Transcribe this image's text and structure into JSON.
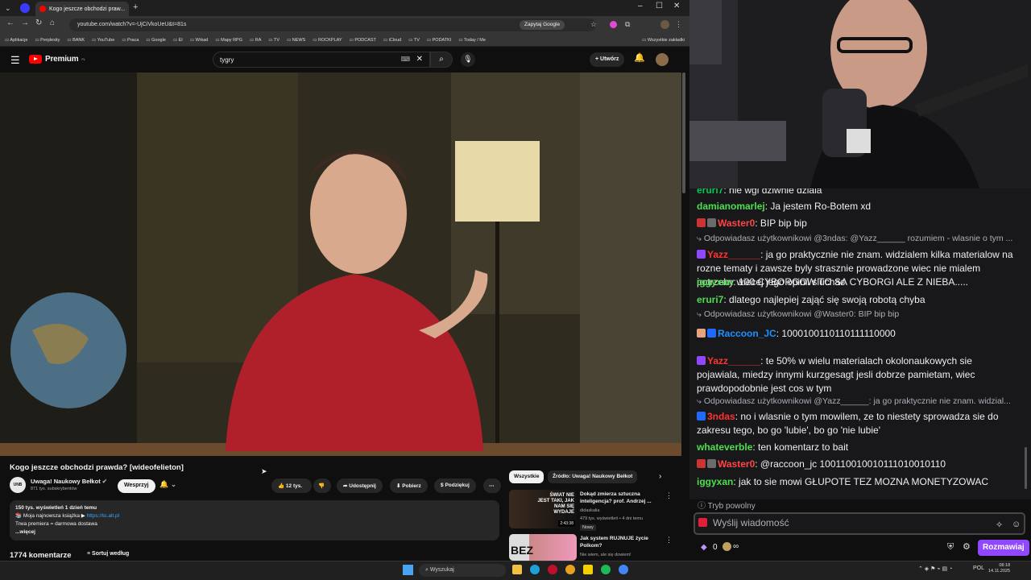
{
  "browser": {
    "tab_title": "Kogo jeszcze obchodzi praw...",
    "url": "youtube.com/watch?v=-UjCiVkoUeU&t=81s",
    "ask_google": "Zapytaj Google",
    "bookmarks": [
      "Aplikacje",
      "Perplexity",
      "BANK",
      "YouTube",
      "Praca",
      "Google",
      "EI",
      "Wrkad",
      "Mapy RPG",
      "RA",
      "TV",
      "NEWS",
      "ROCKPLAY",
      "PODCAST",
      "iCloud",
      "TV",
      "PODATKI",
      "Today / Me"
    ],
    "all_bookmarks": "Wszystkie zakładki"
  },
  "youtube": {
    "logo": "Premium",
    "logo_region": "PL",
    "search_value": "tygry",
    "create_label": "Utwórz",
    "video_title": "Kogo jeszcze obchodzi prawda? [wideofelieton]",
    "channel_avatar_text": "UNB",
    "channel_name": "Uwaga! Naukowy Bełkot",
    "subscribers": "871 tys. subskrybentów",
    "support_label": "Wesprzyj",
    "likes": "12 tys.",
    "share_label": "Udostępnij",
    "download_label": "Pobierz",
    "thanks_label": "Podziękuj",
    "desc_stats": "150 tys. wyświetleń  1 dzień temu",
    "desc_line1": "📚 Moja najnowsza książka ▶",
    "desc_link": "https://to.alt.pl",
    "desc_line2": "Trwa premiera = darmowa dostawa",
    "desc_more": "...więcej",
    "comments_count": "1774 komentarze",
    "sort_label": "Sortuj według",
    "chips": [
      "Wszystkie",
      "Źródło: Uwaga! Naukowy Bełkot"
    ],
    "recommended": [
      {
        "title": "Dokąd zmierza sztuczna inteligencja? prof. Andrzej ...",
        "channel": "didaskalia",
        "meta": "479 tys. wyświetleń • 4 dni temu",
        "badge": "Nowy",
        "duration": "2:43:38",
        "thumb_text": "ŚWIAT NIE JEST TAKI, JAK NAM SIĘ WYDAJE"
      },
      {
        "title": "Jak system RUJNUJE życie Polkom?",
        "channel": "Nie wiem, ale się dowiem!",
        "meta": "",
        "badge": "",
        "duration": "",
        "thumb_text": "BEZ"
      }
    ]
  },
  "chat": {
    "messages": [
      {
        "kind": "msg",
        "user": "eruri7",
        "color": "#00c853",
        "badges": [],
        "text": "nie wgl dziwnie dziala"
      },
      {
        "kind": "msg",
        "user": "damianomarlej",
        "color": "#4ddf4d",
        "badges": [],
        "text": "Ja jestem Ro-Botem xd"
      },
      {
        "kind": "msg",
        "user": "Waster0",
        "color": "#ff4545",
        "badges": [
          "#c33",
          "#6b6b6b"
        ],
        "text": "BIP bip bip"
      },
      {
        "kind": "reply",
        "text": "Odpowiadasz użytkownikowi @3ndas: @Yazz______ rozumiem - wlasnie o tym ..."
      },
      {
        "kind": "msg",
        "user": "Yazz______",
        "color": "#ff3333",
        "badges": [
          "#9147ff"
        ],
        "text": "ja go praktycznie nie znam. widzialem kilka materialow na rozne tematy i zawsze byly strasznie prowadzone wiec nie mialem potrzeby wiecej jego opinii sluchac"
      },
      {
        "kind": "msg",
        "user": "iggyxan",
        "color": "#4ddf4d",
        "badges": [],
        "text": "100 CYBORGOW TO SA CYBORGI ALE Z NIEBA....."
      },
      {
        "kind": "msg",
        "user": "eruri7",
        "color": "#4ddf4d",
        "badges": [],
        "text": "dlatego najlepiej zająć się swoją robotą chyba"
      },
      {
        "kind": "reply",
        "text": "Odpowiadasz użytkownikowi @Waster0: BIP bip bip"
      },
      {
        "kind": "msg",
        "user": "Raccoon_JC",
        "color": "#1e90ff",
        "badges": [
          "#e6a57e",
          "#1f69ff"
        ],
        "text": "1000100110110111110000"
      },
      {
        "kind": "msg",
        "user": "Yazz______",
        "color": "#ff3333",
        "badges": [
          "#9147ff"
        ],
        "text": "te 50% w wielu materialach okolonaukowych sie pojawiala, miedzy innymi kurzgesagt jesli dobrze pamietam, wiec prawdopodobnie jest cos w tym"
      },
      {
        "kind": "reply",
        "text": "Odpowiadasz użytkownikowi @Yazz______: ja go praktycznie nie znam. widzial..."
      },
      {
        "kind": "msg",
        "user": "3ndas",
        "color": "#ff3333",
        "badges": [
          "#1f69ff"
        ],
        "text": "no i wlasnie o tym mowilem, ze to niestety sprowadza sie do zakresu tego, bo go 'lubie', bo go 'nie lubie'"
      },
      {
        "kind": "msg",
        "user": "whateverble",
        "color": "#4ddf4d",
        "badges": [],
        "text": "ten komentarz to bait"
      },
      {
        "kind": "msg",
        "user": "Waster0",
        "color": "#ff4545",
        "badges": [
          "#c33",
          "#6b6b6b"
        ],
        "text": "@raccoon_jc 100110010010111010010110"
      },
      {
        "kind": "msg",
        "user": "iggyxan",
        "color": "#4ddf4d",
        "badges": [],
        "text": "jak to sie mowi GŁUPOTE TEZ MOZNA MONETYZOWAC"
      }
    ],
    "slow_mode": "Tryb powolny",
    "input_placeholder": "Wyślij wiadomość",
    "points": "0",
    "infinity": "∞",
    "chat_button": "Rozmawiaj"
  },
  "taskbar": {
    "search_placeholder": "Wyszukaj",
    "lang": "POL",
    "time": "08:18",
    "date": "14.11.2025"
  }
}
